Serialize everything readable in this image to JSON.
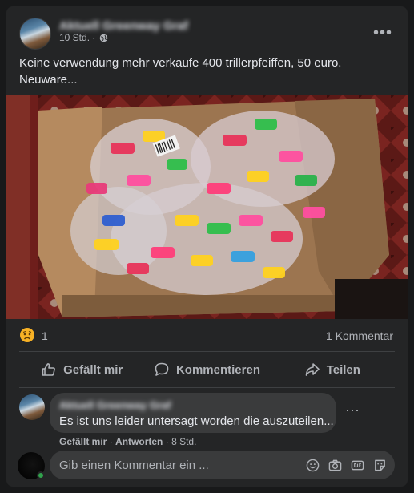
{
  "post": {
    "author": "Aktuell Greenway Graf",
    "time": "10 Std.",
    "time_separator": "·",
    "privacy_icon": "globe-icon",
    "more_label": "•••",
    "text": "Keine verwendung mehr verkaufe 400 trillerpfeiffen, 50 euro. Neuware..."
  },
  "stats": {
    "reaction_icon": "sad-reaction-icon",
    "reaction_count": "1",
    "comment_count": "1 Kommentar"
  },
  "actions": {
    "like": "Gefällt mir",
    "comment": "Kommentieren",
    "share": "Teilen"
  },
  "comment": {
    "author": "Aktuell Greenway Graf",
    "text": "Es ist uns leider untersagt worden die auszuteilen...",
    "more_label": "···",
    "like": "Gefällt mir",
    "separator": "·",
    "reply": "Antworten",
    "time": "8 Std."
  },
  "composer": {
    "placeholder": "Gib einen Kommentar ein ...",
    "icons": [
      "emoji-icon",
      "camera-icon",
      "gif-icon",
      "sticker-icon"
    ]
  },
  "colors": {
    "card": "#242526",
    "background": "#18191a",
    "text_primary": "#e4e6eb",
    "text_secondary": "#b0b3b8",
    "bubble": "#3a3b3c",
    "online": "#31a24c"
  }
}
